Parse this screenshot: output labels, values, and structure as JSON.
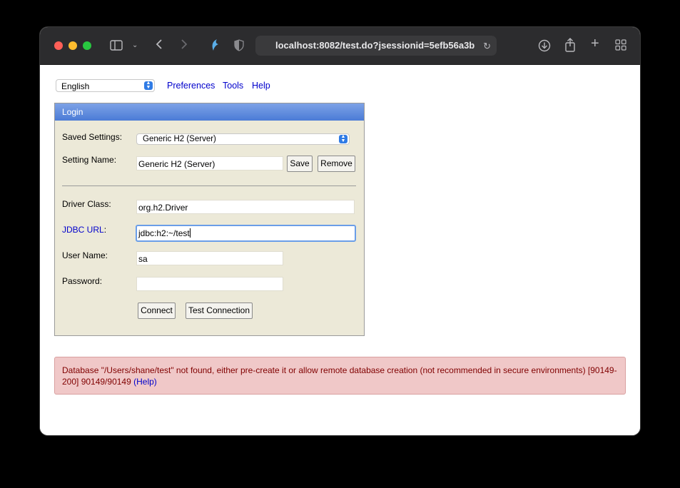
{
  "browser": {
    "url": "localhost:8082/test.do?jsessionid=5efb56a3b"
  },
  "toolbar": {
    "language": "English",
    "links": [
      "Preferences",
      "Tools",
      "Help"
    ]
  },
  "login": {
    "title": "Login",
    "saved_settings_label": "Saved Settings:",
    "saved_settings_value": "Generic H2 (Server)",
    "setting_name_label": "Setting Name:",
    "setting_name_value": "Generic H2 (Server)",
    "save_label": "Save",
    "remove_label": "Remove",
    "driver_class_label": "Driver Class:",
    "driver_class_value": "org.h2.Driver",
    "jdbc_url_label": "JDBC URL",
    "jdbc_url_colon": ":",
    "jdbc_url_value": "jdbc:h2:~/test",
    "user_name_label": "User Name:",
    "user_name_value": "sa",
    "password_label": "Password:",
    "password_value": "",
    "connect_label": "Connect",
    "test_connection_label": "Test Connection"
  },
  "error": {
    "message": "Database \"/Users/shane/test\" not found, either pre-create it or allow remote database creation (not recommended in secure environments) [90149-200] 90149/90149",
    "help_link": "(Help)"
  },
  "colors": {
    "accent": "#2f7be5",
    "login_header": "#4b7bd6",
    "panel_bg": "#ece9d8",
    "error_bg": "#f0c8c8",
    "error_text": "#800000",
    "link": "#0000cc"
  }
}
